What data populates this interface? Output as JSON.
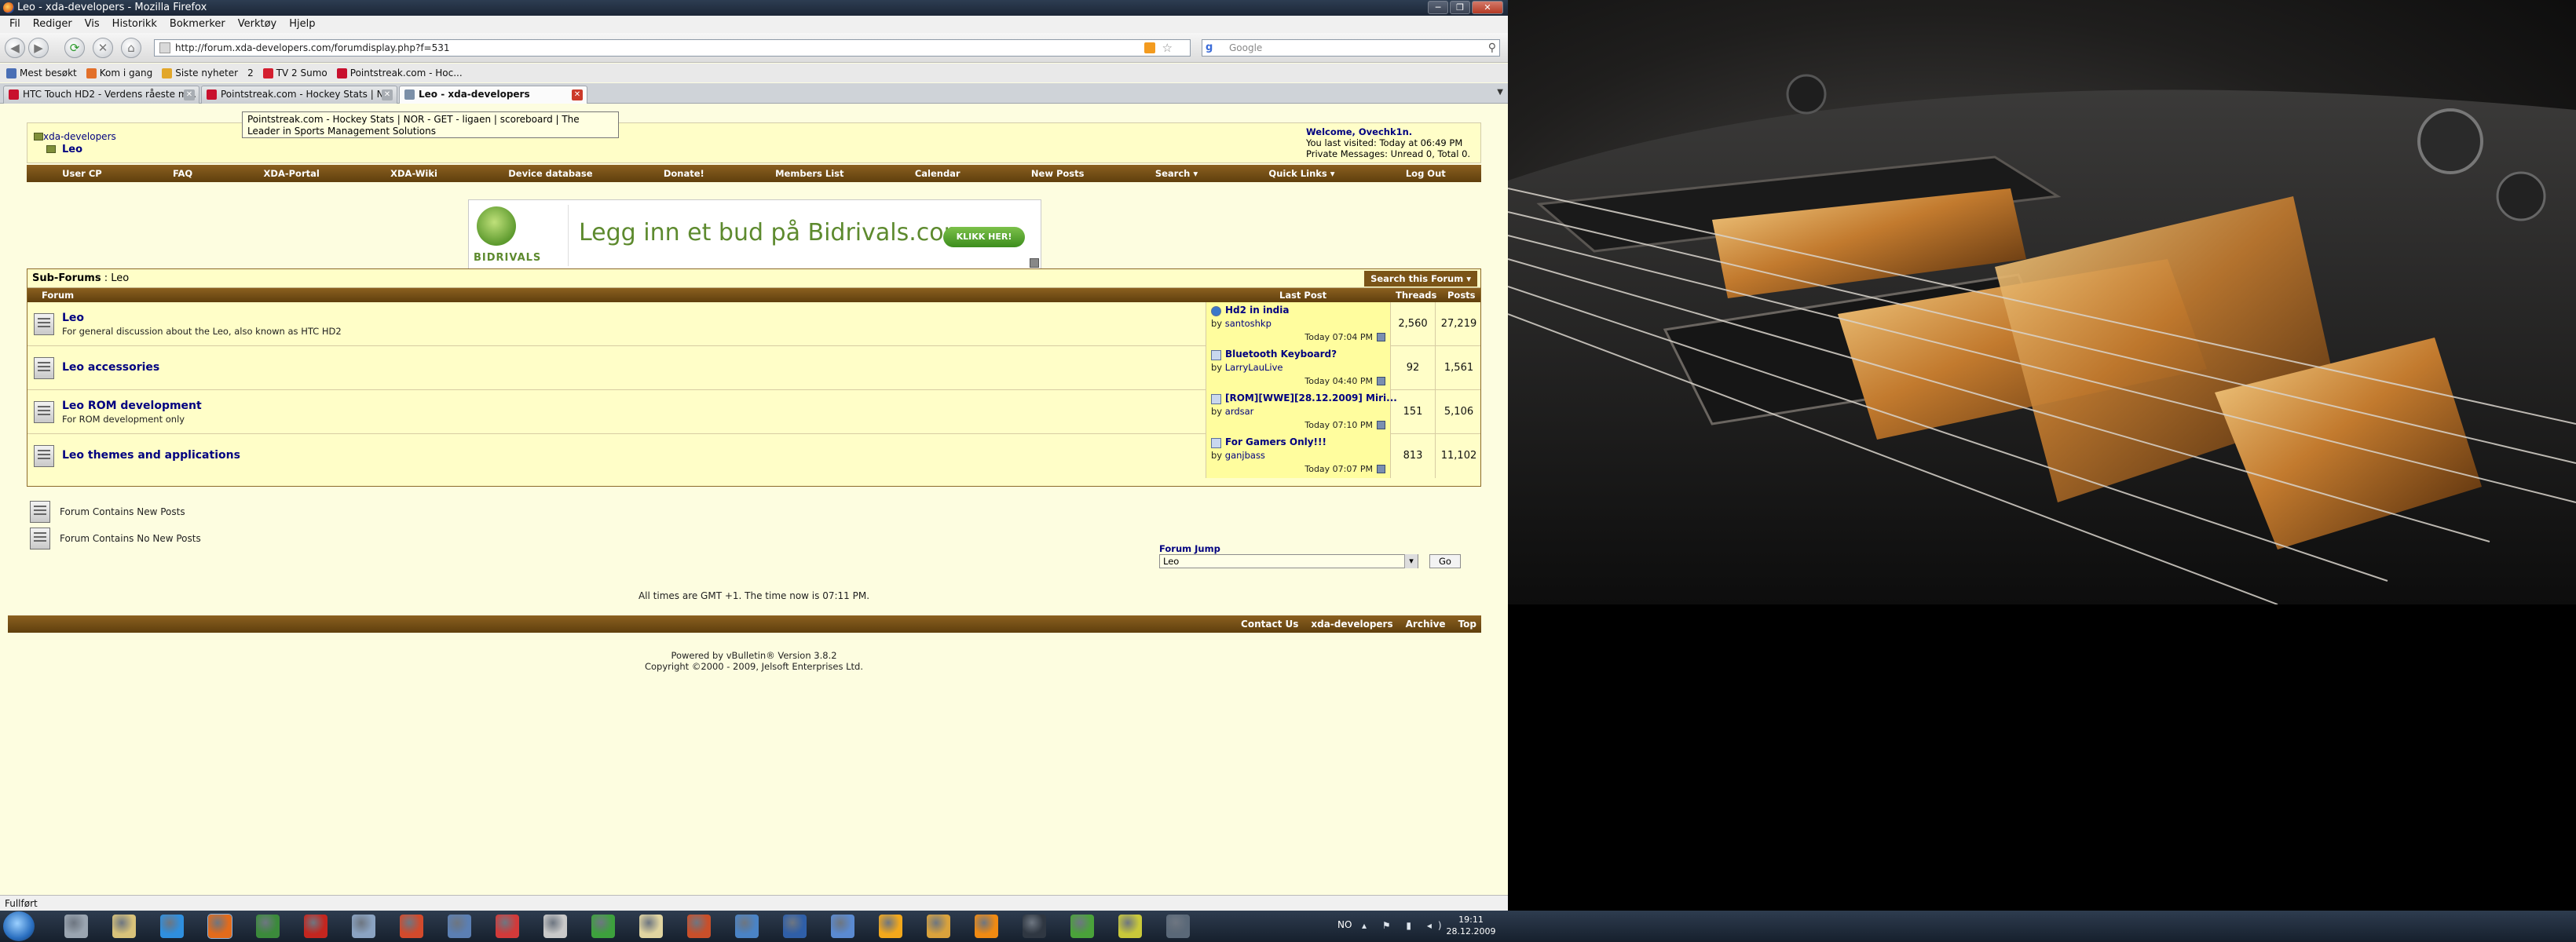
{
  "window": {
    "title": "Leo - xda-developers - Mozilla Firefox",
    "controls": [
      "─",
      "❐",
      "✕"
    ]
  },
  "menu": [
    "Fil",
    "Rediger",
    "Vis",
    "Historikk",
    "Bokmerker",
    "Verktøy",
    "Hjelp"
  ],
  "navigation": {
    "url": "http://forum.xda-developers.com/forumdisplay.php?f=531",
    "search_placeholder": "Google",
    "search_engine_glyph": "g"
  },
  "bookmarks": [
    {
      "label": "Mest besøkt",
      "color": "#4a6fb5"
    },
    {
      "label": "Kom i gang",
      "color": "#e2702a"
    },
    {
      "label": "Siste nyheter",
      "color": "#e2a72a"
    },
    {
      "label": "2",
      "color": "#ffffff"
    },
    {
      "label": "TV 2 Sumo",
      "color": "#d41f2f"
    },
    {
      "label": "Pointstreak.com - Hoc...",
      "color": "#c8102e"
    }
  ],
  "tabs": [
    {
      "label": "HTC Touch HD2 - Verdens råeste m...",
      "color": "#c8102e",
      "active": false
    },
    {
      "label": "Pointstreak.com - Hockey Stats | N...",
      "color": "#c8102e",
      "active": false
    },
    {
      "label": "Leo - xda-developers",
      "color": "#7b8fa8",
      "active": true
    }
  ],
  "tooltip": "Pointstreak.com - Hockey Stats | NOR - GET - ligaen | scoreboard | The Leader in Sports Management Solutions",
  "breadcrumb": {
    "root": "xda-developers",
    "current": "Leo"
  },
  "welcome": {
    "greeting": "Welcome, Ovechk1n.",
    "last_visited": "You last visited: Today at 06:49 PM",
    "private_messages": "Private Messages: Unread 0, Total 0."
  },
  "nav_links": [
    "User CP",
    "FAQ",
    "XDA-Portal",
    "XDA-Wiki",
    "Device database",
    "Donate!",
    "Members List",
    "Calendar",
    "New Posts",
    "Search ▾",
    "Quick Links ▾",
    "Log Out"
  ],
  "ad": {
    "brand": "BIDRIVALS",
    "headline": "Legg inn et bud på Bidrivals.com",
    "cta": "KLIKK HER!"
  },
  "subforums": {
    "title": "Sub-Forums",
    "separator": ":",
    "parent": "Leo",
    "search_button": "Search this Forum ▾",
    "columns": {
      "forum": "Forum",
      "last_post": "Last Post",
      "threads": "Threads",
      "posts": "Posts"
    },
    "rows": [
      {
        "name": "Leo",
        "description": "For general discussion about the Leo, also known as HTC HD2",
        "last_title": "Hd2 in india",
        "by": "santoshkp",
        "time": "Today 07:04 PM",
        "threads": "2,560",
        "posts": "27,219"
      },
      {
        "name": "Leo accessories",
        "description": "",
        "last_title": "Bluetooth Keyboard?",
        "by": "LarryLauLive",
        "time": "Today 04:40 PM",
        "threads": "92",
        "posts": "1,561"
      },
      {
        "name": "Leo ROM development",
        "description": "For ROM development only",
        "last_title": "[ROM][WWE][28.12.2009] Miri...",
        "by": "ardsar",
        "time": "Today 07:10 PM",
        "threads": "151",
        "posts": "5,106"
      },
      {
        "name": "Leo themes and applications",
        "description": "",
        "last_title": "For Gamers Only!!!",
        "by": "ganjbass",
        "time": "Today 07:07 PM",
        "threads": "813",
        "posts": "11,102"
      }
    ],
    "by_prefix": "by"
  },
  "legend": {
    "new": "Forum Contains New Posts",
    "none": "Forum Contains No New Posts"
  },
  "forum_jump": {
    "label": "Forum Jump",
    "selected": "Leo",
    "go": "Go"
  },
  "times_note": "All times are GMT +1. The time now is 07:11 PM.",
  "footer_links": [
    "Contact Us",
    "xda-developers",
    "Archive",
    "Top"
  ],
  "powered_by": "Powered by vBulletin® Version 3.8.2",
  "copyright": "Copyright ©2000 - 2009, Jelsoft Enterprises Ltd.",
  "status": "Fullført",
  "taskbar": {
    "language": "NO",
    "tray_glyphs": "▴ ⚑ ▮ ◂)",
    "time": "19:11",
    "date": "28.12.2009",
    "apps": [
      {
        "name": "explorer-app-icon",
        "color": "#9aa5b1"
      },
      {
        "name": "folder-app-icon",
        "color": "#d8c27a"
      },
      {
        "name": "ie-app-icon",
        "color": "#2f8fde"
      },
      {
        "name": "firefox-app-icon",
        "color": "#e36b1b"
      },
      {
        "name": "network-app-icon",
        "color": "#3b8a3b"
      },
      {
        "name": "mail-app-icon",
        "color": "#c4261f"
      },
      {
        "name": "doc-app-icon",
        "color": "#8aa3c2"
      },
      {
        "name": "media-app-icon",
        "color": "#d24a2c"
      },
      {
        "name": "monitor-app-icon",
        "color": "#5b7fb3"
      },
      {
        "name": "game-app-icon",
        "color": "#d23a3a"
      },
      {
        "name": "tool-app-icon",
        "color": "#c9c9c9"
      },
      {
        "name": "game2-app-icon",
        "color": "#3da13d"
      },
      {
        "name": "notes-app-icon",
        "color": "#e0d4a0"
      },
      {
        "name": "box-app-icon",
        "color": "#c94f2a"
      },
      {
        "name": "grid-app-icon",
        "color": "#4a83c5"
      },
      {
        "name": "globe-app-icon",
        "color": "#2f5fa8"
      },
      {
        "name": "pin-app-icon",
        "color": "#5a8ad1"
      },
      {
        "name": "sun-app-icon",
        "color": "#f2a81c"
      },
      {
        "name": "pencil-app-icon",
        "color": "#d9a23c"
      },
      {
        "name": "vlc-app-icon",
        "color": "#f08a12"
      },
      {
        "name": "pen-app-icon",
        "color": "#2f3742"
      },
      {
        "name": "utorrent-app-icon",
        "color": "#4aa23a"
      },
      {
        "name": "disc-app-icon",
        "color": "#c9c93a"
      },
      {
        "name": "wallpaper-app-icon",
        "color": "#5a6878"
      }
    ]
  }
}
